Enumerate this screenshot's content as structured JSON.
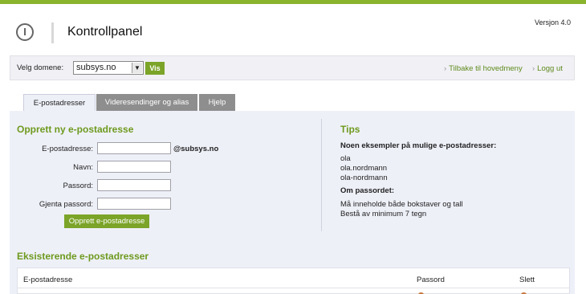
{
  "header": {
    "title": "Kontrollpanel",
    "version": "Versjon 4.0"
  },
  "domainbar": {
    "label": "Velg domene:",
    "selected": "subsys.no",
    "vis_label": "Vis",
    "back_link": "Tilbake til hovedmeny",
    "logout_link": "Logg ut"
  },
  "tabs": [
    {
      "label": "E-postadresser",
      "active": true
    },
    {
      "label": "Videresendinger og alias",
      "active": false
    },
    {
      "label": "Hjelp",
      "active": false
    }
  ],
  "create": {
    "title": "Opprett ny e-postadresse",
    "email_label": "E-postadresse:",
    "email_value": "",
    "domain_suffix": "@subsys.no",
    "name_label": "Navn:",
    "name_value": "",
    "password_label": "Passord:",
    "password_value": "",
    "repeat_label": "Gjenta passord:",
    "repeat_value": "",
    "button": "Opprett e-postadresse"
  },
  "tips": {
    "title": "Tips",
    "examples_heading": "Noen eksempler på mulige e-postadresser:",
    "examples": [
      "ola",
      "ola.nordmann",
      "ola-nordmann"
    ],
    "password_heading": "Om passordet:",
    "password_rules": [
      "Må inneholde både bokstaver og tall",
      "Bestå av minimum 7 tegn"
    ]
  },
  "existing": {
    "title": "Eksisterende e-postadresser",
    "columns": [
      "E-postadresse",
      "Passord",
      "Slett"
    ]
  },
  "colors": {
    "accent": "#8ab32e",
    "button": "#7ba428",
    "link": "#5f8a1b",
    "panel": "#eef0f8"
  }
}
